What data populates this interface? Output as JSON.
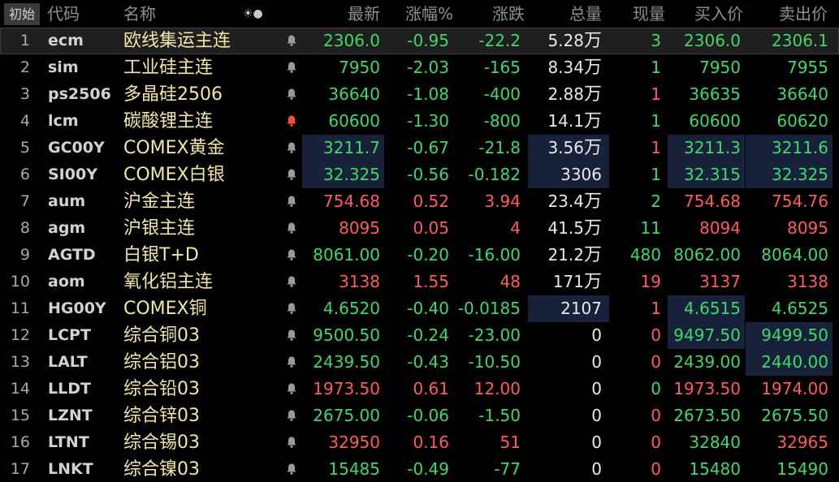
{
  "header": {
    "corner_label": "初始",
    "code": "代码",
    "name": "名称",
    "icons": "☀●",
    "last": "最新",
    "change_pct": "涨幅%",
    "change": "涨跌",
    "volume": "总量",
    "current_vol": "现量",
    "bid": "买入价",
    "ask": "卖出价"
  },
  "colors": {
    "up": "#ff5b5b",
    "down": "#3fd86a",
    "name_text": "#f2e6a6",
    "highlight": "#17223a"
  },
  "rows": [
    {
      "idx": "1",
      "code": "ecm",
      "name": "欧线集运主连",
      "bell": "off",
      "last": "2306.0",
      "pct": "-0.95",
      "chg": "-22.2",
      "vol": "5.28",
      "vol_unit": "万",
      "cur": "3",
      "bid": "2306.0",
      "ask": "2306.1",
      "dir": "down",
      "cur_dir": "down",
      "bid_dir": "down",
      "ask_dir": "down",
      "selected": true
    },
    {
      "idx": "2",
      "code": "sim",
      "name": "工业硅主连",
      "bell": "off",
      "last": "7950",
      "pct": "-2.03",
      "chg": "-165",
      "vol": "8.34",
      "vol_unit": "万",
      "cur": "1",
      "bid": "7950",
      "ask": "7955",
      "dir": "down",
      "cur_dir": "down",
      "bid_dir": "down",
      "ask_dir": "down"
    },
    {
      "idx": "3",
      "code": "ps2506",
      "name": "多晶硅2506",
      "bell": "off",
      "last": "36640",
      "pct": "-1.08",
      "chg": "-400",
      "vol": "2.88",
      "vol_unit": "万",
      "cur": "1",
      "bid": "36635",
      "ask": "36640",
      "dir": "down",
      "cur_dir": "up",
      "bid_dir": "down",
      "ask_dir": "down"
    },
    {
      "idx": "4",
      "code": "lcm",
      "name": "碳酸锂主连",
      "bell": "on",
      "last": "60600",
      "pct": "-1.30",
      "chg": "-800",
      "vol": "14.1",
      "vol_unit": "万",
      "cur": "1",
      "bid": "60600",
      "ask": "60620",
      "dir": "down",
      "cur_dir": "down",
      "bid_dir": "down",
      "ask_dir": "down"
    },
    {
      "idx": "5",
      "code": "GC00Y",
      "name": "COMEX黄金",
      "bell": "off",
      "last": "3211.7",
      "pct": "-0.67",
      "chg": "-21.8",
      "vol": "3.56",
      "vol_unit": "万",
      "cur": "1",
      "bid": "3211.3",
      "ask": "3211.6",
      "dir": "down",
      "cur_dir": "up",
      "bid_dir": "down",
      "ask_dir": "down",
      "hl": [
        "last",
        "vol",
        "bid",
        "ask"
      ]
    },
    {
      "idx": "6",
      "code": "SI00Y",
      "name": "COMEX白银",
      "bell": "off",
      "last": "32.325",
      "pct": "-0.56",
      "chg": "-0.182",
      "vol": "3306",
      "vol_unit": "",
      "cur": "1",
      "bid": "32.315",
      "ask": "32.325",
      "dir": "down",
      "cur_dir": "down",
      "bid_dir": "down",
      "ask_dir": "down",
      "hl": [
        "last",
        "vol",
        "bid",
        "ask"
      ]
    },
    {
      "idx": "7",
      "code": "aum",
      "name": "沪金主连",
      "bell": "off",
      "last": "754.68",
      "pct": "0.52",
      "chg": "3.94",
      "vol": "23.4",
      "vol_unit": "万",
      "cur": "2",
      "bid": "754.68",
      "ask": "754.76",
      "dir": "up",
      "cur_dir": "down",
      "bid_dir": "up",
      "ask_dir": "up"
    },
    {
      "idx": "8",
      "code": "agm",
      "name": "沪银主连",
      "bell": "off",
      "last": "8095",
      "pct": "0.05",
      "chg": "4",
      "vol": "41.5",
      "vol_unit": "万",
      "cur": "11",
      "bid": "8094",
      "ask": "8095",
      "dir": "up",
      "cur_dir": "down",
      "bid_dir": "up",
      "ask_dir": "up"
    },
    {
      "idx": "9",
      "code": "AGTD",
      "name": "白银T+D",
      "bell": "off",
      "last": "8061.00",
      "pct": "-0.20",
      "chg": "-16.00",
      "vol": "21.2",
      "vol_unit": "万",
      "cur": "480",
      "bid": "8062.00",
      "ask": "8064.00",
      "dir": "down",
      "cur_dir": "down",
      "bid_dir": "down",
      "ask_dir": "down"
    },
    {
      "idx": "10",
      "code": "aom",
      "name": "氧化铝主连",
      "bell": "off",
      "last": "3138",
      "pct": "1.55",
      "chg": "48",
      "vol": "171",
      "vol_unit": "万",
      "cur": "19",
      "bid": "3137",
      "ask": "3138",
      "dir": "up",
      "cur_dir": "up",
      "bid_dir": "up",
      "ask_dir": "up"
    },
    {
      "idx": "11",
      "code": "HG00Y",
      "name": "COMEX铜",
      "bell": "off",
      "last": "4.6520",
      "pct": "-0.40",
      "chg": "-0.0185",
      "vol": "2107",
      "vol_unit": "",
      "cur": "1",
      "bid": "4.6515",
      "ask": "4.6525",
      "dir": "down",
      "cur_dir": "up",
      "bid_dir": "down",
      "ask_dir": "down",
      "hl": [
        "vol",
        "bid"
      ]
    },
    {
      "idx": "12",
      "code": "LCPT",
      "name": "综合铜03",
      "bell": "off",
      "last": "9500.50",
      "pct": "-0.24",
      "chg": "-23.00",
      "vol": "0",
      "vol_unit": "",
      "cur": "0",
      "bid": "9497.50",
      "ask": "9499.50",
      "dir": "down",
      "cur_dir": "up",
      "bid_dir": "down",
      "ask_dir": "down",
      "hl": [
        "bid",
        "ask"
      ]
    },
    {
      "idx": "13",
      "code": "LALT",
      "name": "综合铝03",
      "bell": "off",
      "last": "2439.50",
      "pct": "-0.43",
      "chg": "-10.50",
      "vol": "0",
      "vol_unit": "",
      "cur": "0",
      "bid": "2439.00",
      "ask": "2440.00",
      "dir": "down",
      "cur_dir": "up",
      "bid_dir": "down",
      "ask_dir": "down",
      "hl": [
        "ask"
      ]
    },
    {
      "idx": "14",
      "code": "LLDT",
      "name": "综合铅03",
      "bell": "off",
      "last": "1973.50",
      "pct": "0.61",
      "chg": "12.00",
      "vol": "0",
      "vol_unit": "",
      "cur": "0",
      "bid": "1973.50",
      "ask": "1974.00",
      "dir": "up",
      "cur_dir": "down",
      "bid_dir": "up",
      "ask_dir": "up"
    },
    {
      "idx": "15",
      "code": "LZNT",
      "name": "综合锌03",
      "bell": "off",
      "last": "2675.00",
      "pct": "-0.06",
      "chg": "-1.50",
      "vol": "0",
      "vol_unit": "",
      "cur": "0",
      "bid": "2673.50",
      "ask": "2675.50",
      "dir": "down",
      "cur_dir": "up",
      "bid_dir": "down",
      "ask_dir": "down"
    },
    {
      "idx": "16",
      "code": "LTNT",
      "name": "综合锡03",
      "bell": "off",
      "last": "32950",
      "pct": "0.16",
      "chg": "51",
      "vol": "0",
      "vol_unit": "",
      "cur": "0",
      "bid": "32840",
      "ask": "32965",
      "dir": "up",
      "cur_dir": "up",
      "bid_dir": "down",
      "ask_dir": "up"
    },
    {
      "idx": "17",
      "code": "LNKT",
      "name": "综合镍03",
      "bell": "off",
      "last": "15485",
      "pct": "-0.49",
      "chg": "-77",
      "vol": "0",
      "vol_unit": "",
      "cur": "0",
      "bid": "15480",
      "ask": "15490",
      "dir": "down",
      "cur_dir": "up",
      "bid_dir": "down",
      "ask_dir": "down"
    }
  ]
}
